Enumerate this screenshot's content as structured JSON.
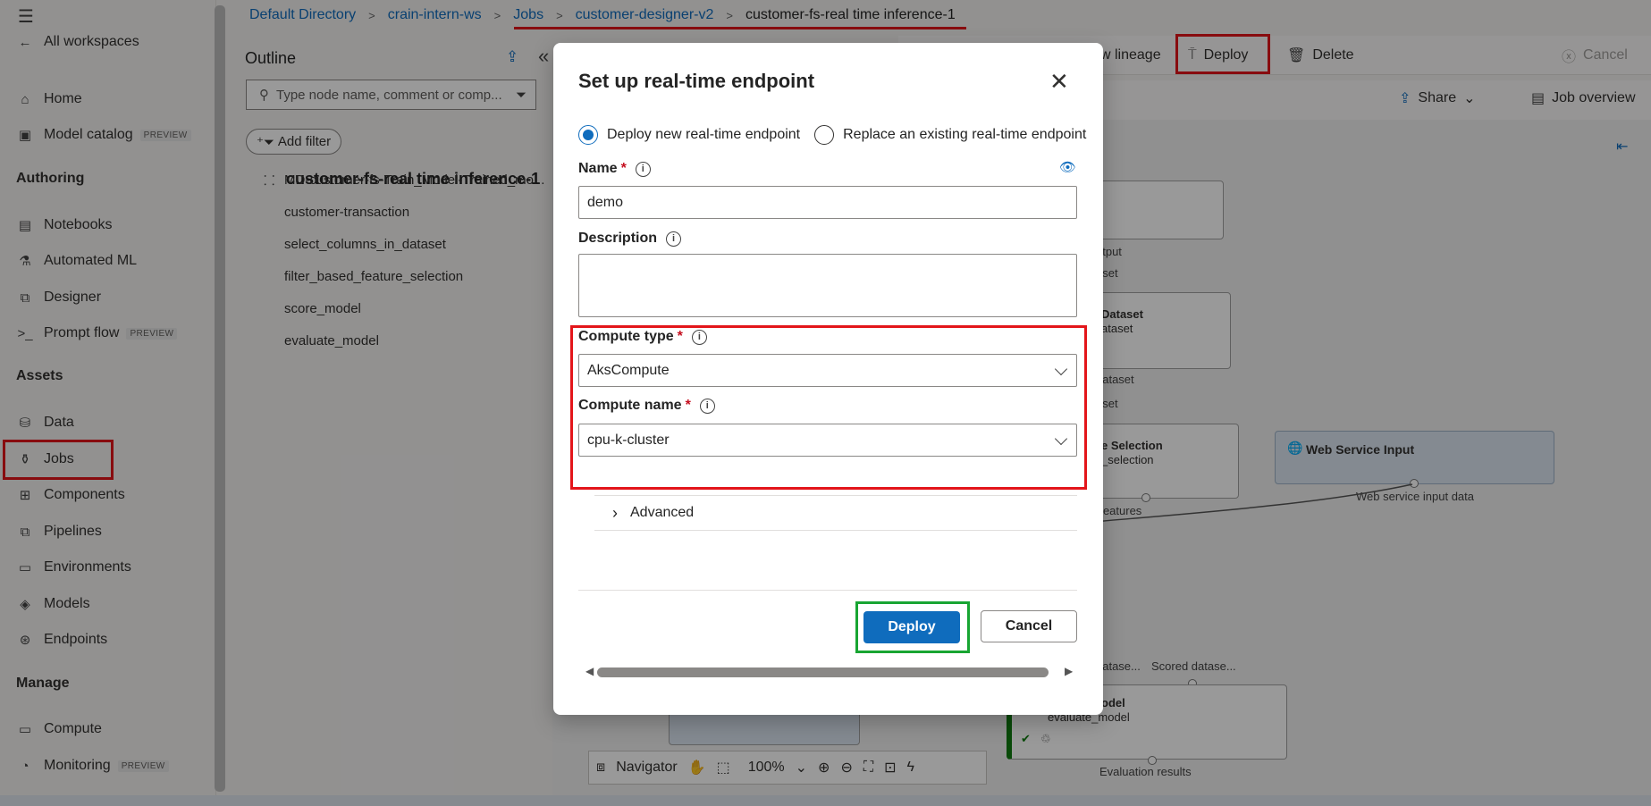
{
  "nav": {
    "all_workspaces": "All workspaces",
    "items": [
      {
        "label": "Home"
      },
      {
        "label": "Model catalog",
        "badge": "PREVIEW"
      },
      {
        "label": "Notebooks"
      },
      {
        "label": "Automated ML"
      },
      {
        "label": "Designer"
      },
      {
        "label": "Prompt flow",
        "badge": "PREVIEW"
      },
      {
        "label": "Data"
      },
      {
        "label": "Jobs"
      },
      {
        "label": "Components"
      },
      {
        "label": "Pipelines"
      },
      {
        "label": "Environments"
      },
      {
        "label": "Models"
      },
      {
        "label": "Endpoints"
      },
      {
        "label": "Compute"
      },
      {
        "label": "Monitoring",
        "badge": "PREVIEW"
      }
    ],
    "sections": [
      "Authoring",
      "Assets",
      "Manage"
    ]
  },
  "breadcrumb": [
    "Default Directory",
    "crain-intern-ws",
    "Jobs",
    "customer-designer-v2",
    "customer-fs-real time inference-1"
  ],
  "outline": {
    "title": "Outline",
    "search_placeholder": "Type node name, comment or comp...",
    "add_filter": "Add filter",
    "root": "customer-fs-real time inference-1",
    "nodes": [
      "MD-customer-fs-Train_Model-Trained_mo...",
      "customer-transaction",
      "select_columns_in_dataset",
      "filter_based_feature_selection",
      "score_model",
      "evaluate_model"
    ]
  },
  "toolbar": {
    "view_lineage": "w lineage",
    "deploy": "Deploy",
    "delete": "Delete",
    "cancel": "Cancel",
    "share": "Share",
    "job_overview": "Job overview"
  },
  "canvas": {
    "labels": {
      "output": "utput",
      "aset1": "aset",
      "dataset_title": "Dataset",
      "dataset_sub": "ataset",
      "dataset_port": "dataset",
      "aset2": "aset",
      "selection_title": "e Selection",
      "selection_sub": "_selection",
      "features": "Features",
      "web_input": "Web Service Input",
      "web_input_port": "Web service input data",
      "scored_left": "datase...",
      "scored_right": "Scored datase...",
      "model_title": "odel",
      "evaluate_model": "evaluate_model",
      "evaluation_results": "Evaluation results"
    },
    "navigator": {
      "label": "Navigator",
      "zoom": "100%"
    }
  },
  "modal": {
    "title": "Set up real-time endpoint",
    "radio_new": "Deploy new real-time endpoint",
    "radio_replace": "Replace an existing real-time endpoint",
    "name_label": "Name",
    "name_value": "demo",
    "description_label": "Description",
    "compute_type_label": "Compute type",
    "compute_type_value": "AksCompute",
    "compute_name_label": "Compute name",
    "compute_name_value": "cpu-k-cluster",
    "advanced": "Advanced",
    "deploy": "Deploy",
    "cancel": "Cancel"
  }
}
